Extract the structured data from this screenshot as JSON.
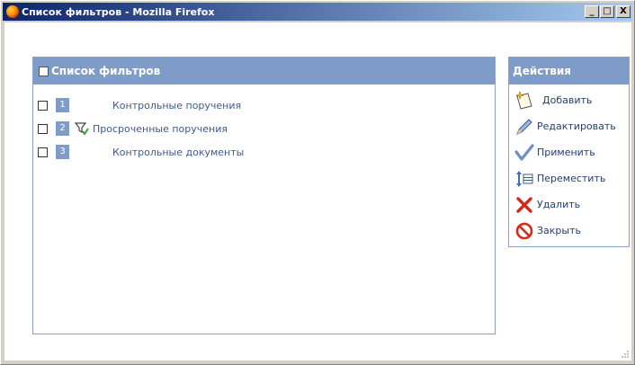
{
  "window": {
    "title": "Список фильтров - Mozilla Firefox",
    "controls": [
      "_",
      "□",
      "X"
    ]
  },
  "filters_panel": {
    "title": "Список фильтров",
    "rows": [
      {
        "num": "1",
        "label": "Контрольные поручения",
        "has_filter_icon": false
      },
      {
        "num": "2",
        "label": "Просроченные поручения",
        "has_filter_icon": true
      },
      {
        "num": "3",
        "label": "Контрольные документы",
        "has_filter_icon": false
      }
    ]
  },
  "actions_panel": {
    "title": "Действия",
    "items": [
      {
        "label": "Добавить",
        "icon": "add-icon"
      },
      {
        "label": "Редактировать",
        "icon": "edit-icon"
      },
      {
        "label": "Применить",
        "icon": "apply-icon"
      },
      {
        "label": "Переместить",
        "icon": "move-icon"
      },
      {
        "label": "Удалить",
        "icon": "delete-icon"
      },
      {
        "label": "Закрыть",
        "icon": "close-icon"
      }
    ]
  },
  "colors": {
    "header_bg": "#7f9cc8",
    "link_text": "#3f5a8a",
    "titlebar_start": "#0a246a"
  }
}
